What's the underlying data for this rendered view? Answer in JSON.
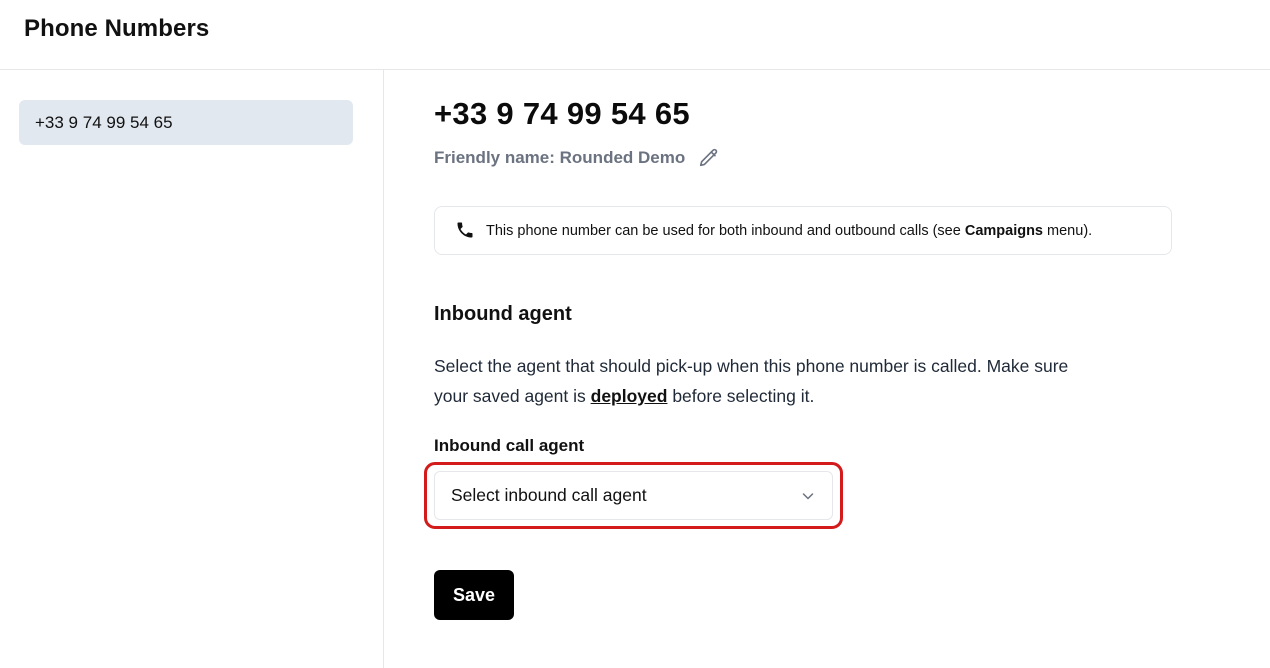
{
  "header": {
    "title": "Phone Numbers"
  },
  "sidebar": {
    "items": [
      {
        "label": "+33 9 74 99 54 65",
        "selected": true
      }
    ]
  },
  "main": {
    "number": "+33 9 74 99 54 65",
    "friendly_prefix": "Friendly name: ",
    "friendly_name": "Rounded Demo",
    "edit_icon": "pencil-icon",
    "info": {
      "icon": "phone-icon",
      "text_before": "This phone number can be used for both inbound and outbound calls (see ",
      "emphasis": "Campaigns",
      "text_after": " menu)."
    },
    "inbound": {
      "title": "Inbound agent",
      "desc_before": "Select the agent that should pick-up when this phone number is called. Make sure your saved agent is ",
      "desc_link": "deployed",
      "desc_after": " before selecting it.",
      "field_label": "Inbound call agent",
      "select_placeholder": "Select inbound call agent",
      "select_icon": "chevron-down-icon"
    },
    "save_label": "Save"
  },
  "colors": {
    "highlight": "#d31b1b",
    "sidebar_selected_bg": "#e2e8f0",
    "primary_button": "#000000"
  }
}
